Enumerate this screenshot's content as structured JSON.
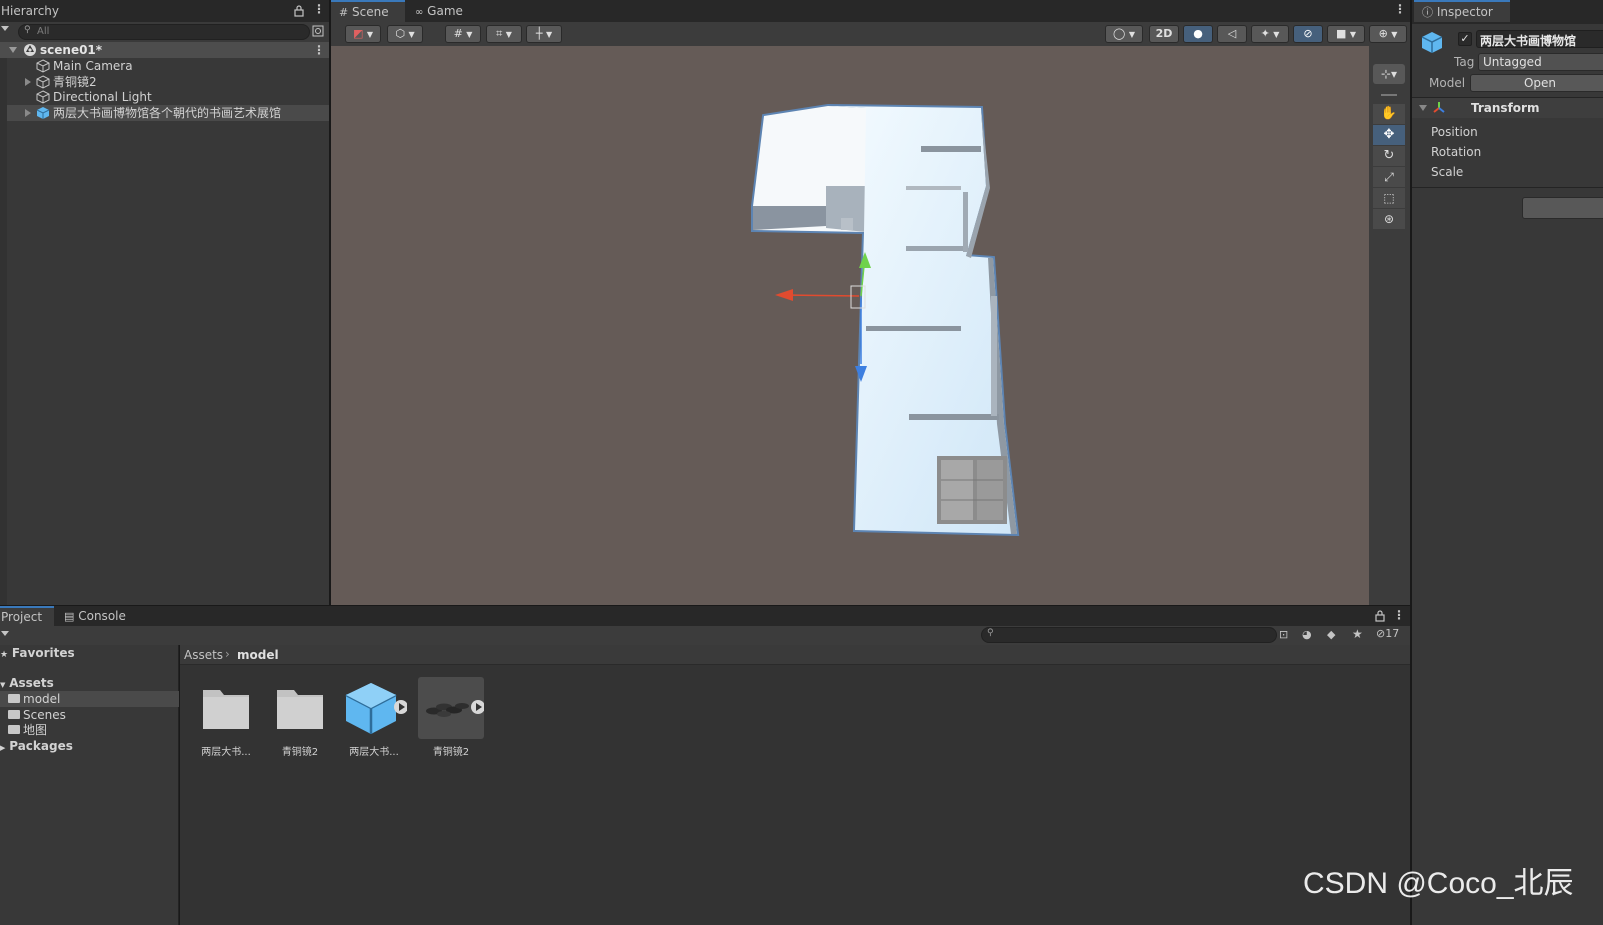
{
  "hierarchy": {
    "tab_label": "Hierarchy",
    "search_placeholder": "All",
    "scene_name": "scene01*",
    "items": [
      {
        "label": "Main Camera"
      },
      {
        "label": "青铜镜2"
      },
      {
        "label": "Directional Light"
      },
      {
        "label": "两层大书画博物馆各个朝代的书画艺术展馆"
      }
    ]
  },
  "scene_view": {
    "tabs": [
      {
        "label": "Scene"
      },
      {
        "label": "Game"
      }
    ],
    "toolbar": {
      "mode_2d_label": "2D"
    }
  },
  "inspector": {
    "tab_label": "Inspector",
    "object_name": "两层大书画博物馆",
    "active": true,
    "tag_label": "Tag",
    "tag_value": "Untagged",
    "model_label": "Model",
    "open_label": "Open",
    "component_title": "Transform",
    "fields": [
      {
        "label": "Position"
      },
      {
        "label": "Rotation"
      },
      {
        "label": "Scale"
      }
    ]
  },
  "project": {
    "tabs": [
      {
        "label": "Project"
      },
      {
        "label": "Console"
      }
    ],
    "hidden_count": "17",
    "breadcrumb": {
      "root": "Assets",
      "current": "model"
    },
    "sidebar": {
      "favorites": "Favorites",
      "assets": "Assets",
      "folders": [
        {
          "label": "model"
        },
        {
          "label": "Scenes"
        },
        {
          "label": "地图"
        }
      ],
      "packages": "Packages"
    },
    "assets": [
      {
        "label": "两层大书...",
        "kind": "folder-icon"
      },
      {
        "label": "青铜镜2",
        "kind": "folder-icon"
      },
      {
        "label": "两层大书...",
        "kind": "prefab-icon"
      },
      {
        "label": "青铜镜2",
        "kind": "model-icon"
      }
    ]
  },
  "watermark": "CSDN @Coco_北辰",
  "colors": {
    "accent": "#3a79bb",
    "scene_background": "#655b57",
    "panel": "#383838",
    "selection": "#4d4d4d"
  }
}
